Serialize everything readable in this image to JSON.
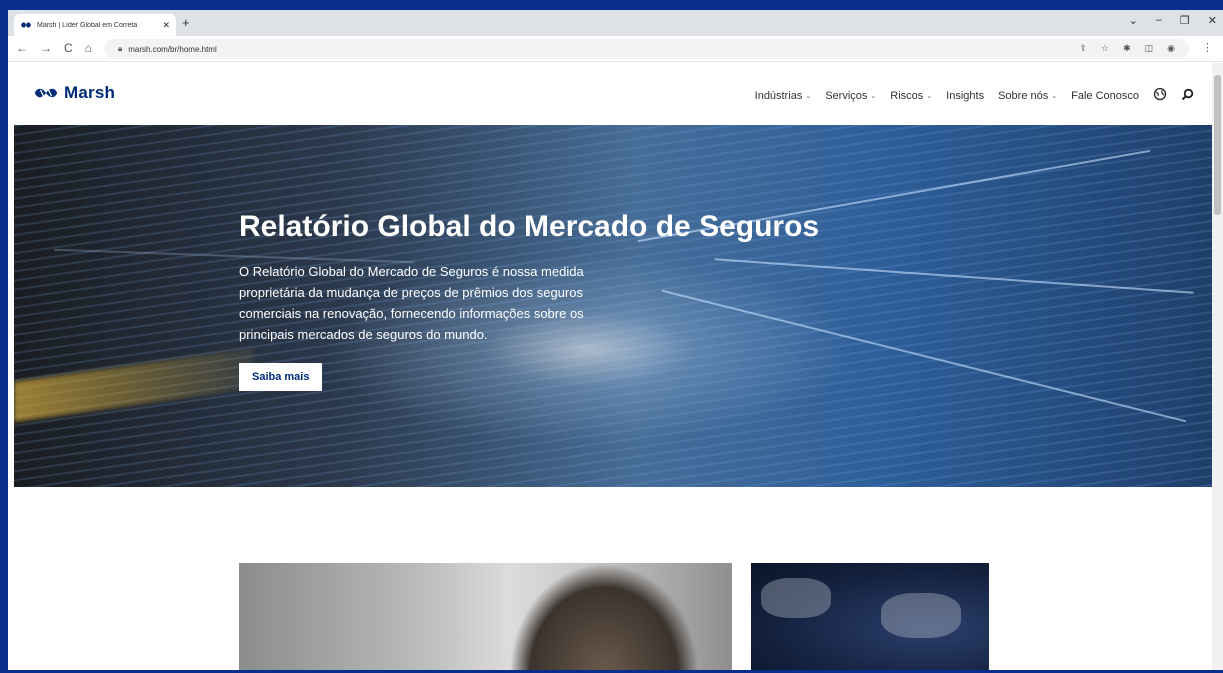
{
  "browser": {
    "tab_title": "Marsh | Líder Global em Correta",
    "tab_close": "✕",
    "new_tab": "+",
    "url": "marsh.com/br/home.html",
    "controls": [
      "⌄",
      "–",
      "❐",
      "✕"
    ]
  },
  "site": {
    "logo_text": "Marsh",
    "nav": [
      {
        "label": "Indústrias",
        "has_dropdown": true
      },
      {
        "label": "Serviços",
        "has_dropdown": true
      },
      {
        "label": "Riscos",
        "has_dropdown": true
      },
      {
        "label": "Insights",
        "has_dropdown": false
      },
      {
        "label": "Sobre nós",
        "has_dropdown": true
      },
      {
        "label": "Fale Conosco",
        "has_dropdown": false
      }
    ],
    "chevron": "⌄",
    "globe_icon": "globe-icon",
    "search_icon": "search-icon"
  },
  "hero": {
    "title": "Relatório Global do Mercado de Seguros",
    "text": "O Relatório Global do Mercado de Seguros é nossa medida proprietária da mudança de preços de prêmios dos seguros comerciais na renovação, fornecendo informações sobre os principais mercados de seguros do mundo.",
    "button_label": "Saiba mais"
  },
  "colors": {
    "brand": "#002c77",
    "frame": "#0b2e8c"
  }
}
